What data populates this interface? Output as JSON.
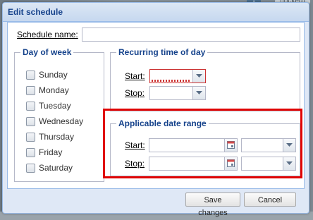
{
  "backdrop": {
    "tag_label": "(locked)"
  },
  "dialog": {
    "title": "Edit schedule",
    "schedule_name": {
      "label": "Schedule name:",
      "value": ""
    },
    "day_of_week": {
      "legend": "Day of week",
      "days": [
        "Sunday",
        "Monday",
        "Tuesday",
        "Wednesday",
        "Thursday",
        "Friday",
        "Saturday"
      ]
    },
    "recurring_time": {
      "legend": "Recurring time of day",
      "start_label": "Start:",
      "stop_label": "Stop:",
      "start_value": "",
      "stop_value": ""
    },
    "date_range": {
      "legend": "Applicable date range",
      "start_label": "Start:",
      "stop_label": "Stop:",
      "start_date": "",
      "start_time": "",
      "stop_date": "",
      "stop_time": ""
    },
    "buttons": {
      "save": "Save changes",
      "cancel": "Cancel"
    }
  },
  "colors": {
    "title_text": "#15428b",
    "dialog_bg": "#dfe8f6",
    "border": "#99bbe8",
    "highlight": "#e00000",
    "invalid": "#cc3333"
  }
}
